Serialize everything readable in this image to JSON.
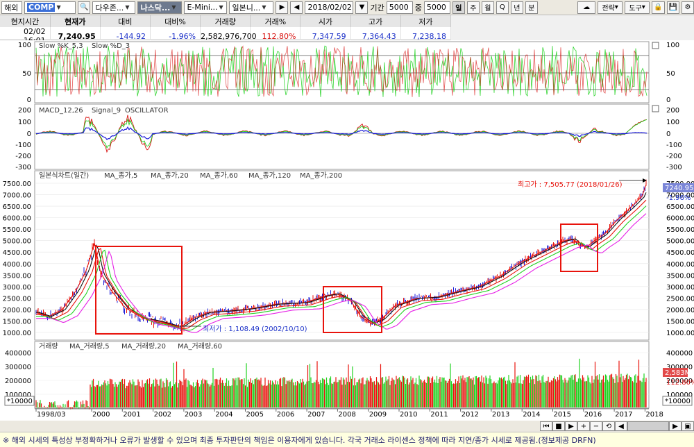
{
  "toolbar": {
    "market": "해외",
    "code": "COMP",
    "exchange": "다우존...",
    "index_name": "나스닥...",
    "futures": "E-Mini...",
    "chart_type": "일본니...",
    "date": "2018/02/02",
    "period_label": "기간",
    "period_value": "5000",
    "count_label": "중",
    "count_value": "5000",
    "intervals": [
      "일",
      "주",
      "월",
      "Q",
      "년",
      "분"
    ],
    "strategy": "전략",
    "tools": "도구"
  },
  "quote": {
    "headers": [
      "현지시간",
      "현재가",
      "대비",
      "대비%",
      "거래량",
      "거래%",
      "시가",
      "고가",
      "저가"
    ],
    "values": [
      "02/02  16:01",
      "7,240.95",
      "-144.92",
      "-1.96%",
      "2,582,976,700",
      "112.80%",
      "7,347.59",
      "7,364.43",
      "7,238.18"
    ]
  },
  "panels": {
    "stoch": {
      "legend": "Slow %K_5,3",
      "legend2": "Slow %D_3",
      "ticks": [
        "100",
        "50",
        "0"
      ]
    },
    "macd": {
      "legend": "MACD_12,26",
      "legend2": "Signal_9",
      "legend3": "OSCILLATOR",
      "ticks": [
        "200",
        "100",
        "0",
        "-100",
        "-200",
        "-300"
      ]
    },
    "price": {
      "legend": "일본식차트(일간)",
      "ma": [
        "MA_종가,5",
        "MA_종가,20",
        "MA_종가,60",
        "MA_종가,120",
        "MA_종가,200"
      ],
      "ticks": [
        "7500.00",
        "7000.00",
        "6500.00",
        "6000.00",
        "5500.00",
        "5000.00",
        "4500.00",
        "4000.00",
        "3500.00",
        "3000.00",
        "2500.00",
        "2000.00",
        "1500.00",
        "1000.00"
      ],
      "high_label": "최고가 : 7,505.77 (2018/01/26)",
      "low_label": "최저가 : 1,108.49 (2002/10/10)",
      "last_price": "7240.95",
      "last_change": "-1.96%"
    },
    "volume": {
      "legend": "거래량",
      "ma": [
        "MA_거래량,5",
        "MA_거래량,20",
        "MA_거래량,60"
      ],
      "ticks": [
        "400000",
        "300000",
        "200000",
        "100000"
      ],
      "unit": "*10000",
      "last_volume": "2,583M",
      "last_ratio": "112.80%"
    }
  },
  "x_axis": [
    "1998/03",
    "2000",
    "2001",
    "2002",
    "2003",
    "2004",
    "2005",
    "2006",
    "2007",
    "2008",
    "2009",
    "2010",
    "2011",
    "2012",
    "2013",
    "2014",
    "2015",
    "2016",
    "2017",
    "2018"
  ],
  "colors": {
    "up": "#e8130c",
    "down": "#1fd11f",
    "ma5": "#e8130c",
    "ma20": "#111111",
    "ma60": "#e8130c",
    "ma120": "#1fd11f",
    "ma200": "#1a1ad8",
    "ma_extra": "#e61ee6",
    "annotation_box": "#e8130c"
  },
  "footer": {
    "notice": "※ 해외 시세의 특성상 부정확하거나 오류가 발생할 수 있으며 최종 투자판단의 책임은 이용자에게 있습니다. 각국 거래소 라이센스 정책에 따라 지연/종가 시세로 제공됨.(정보제공 DRFN)"
  }
}
